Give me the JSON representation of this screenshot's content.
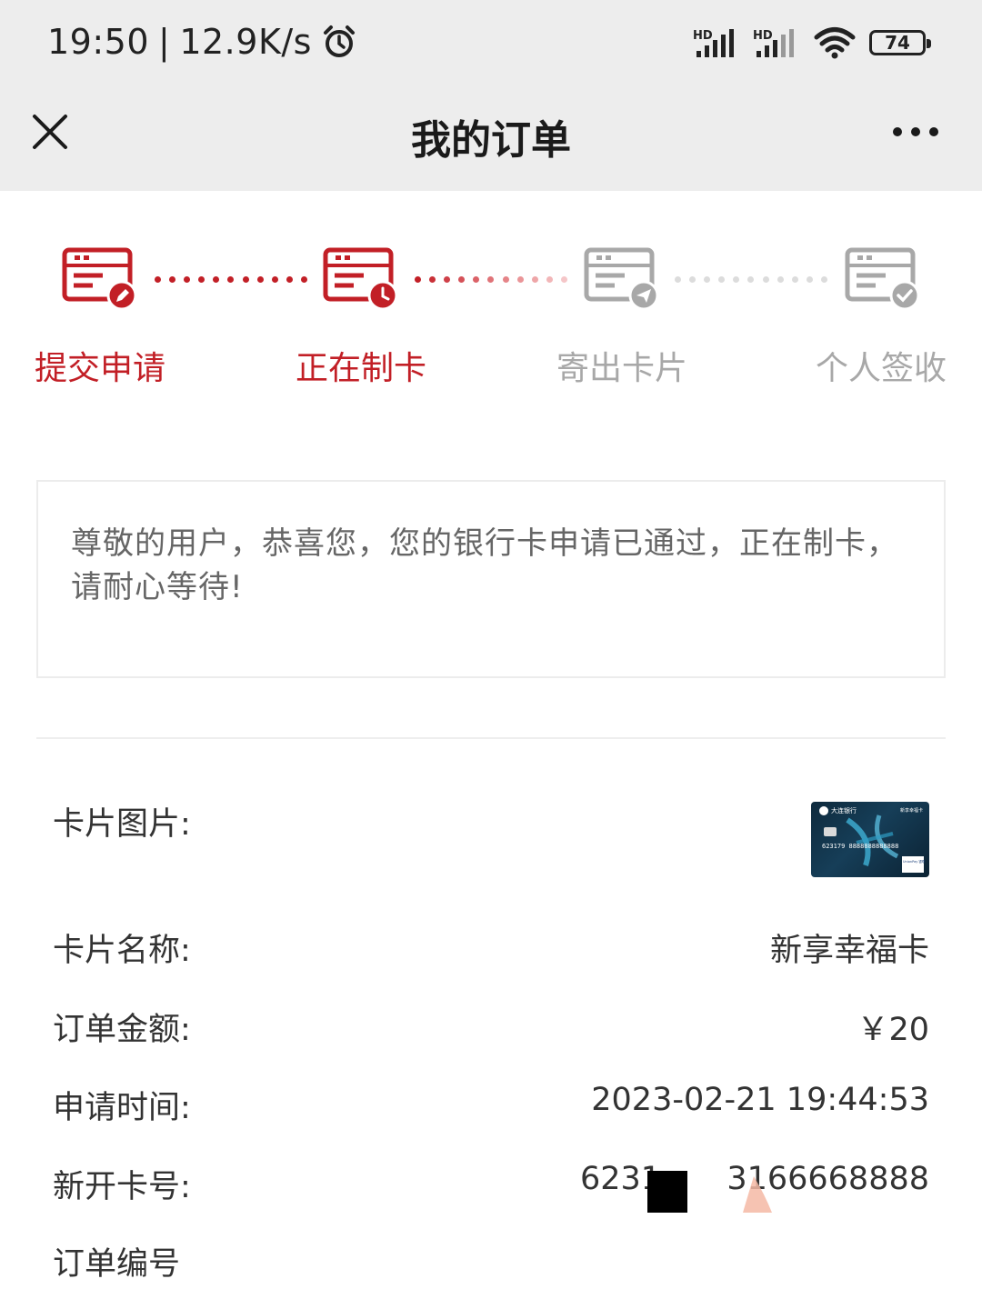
{
  "status_bar": {
    "time": "19:50",
    "separator": "|",
    "speed": "12.9K/s",
    "signal1_label": "HD",
    "signal2_label": "HD",
    "battery": "74"
  },
  "nav": {
    "title": "我的订单"
  },
  "steps": [
    {
      "label": "提交申请",
      "state": "done",
      "icon": "pencil-icon"
    },
    {
      "label": "正在制卡",
      "state": "active",
      "icon": "clock-icon"
    },
    {
      "label": "寄出卡片",
      "state": "pending",
      "icon": "send-icon"
    },
    {
      "label": "个人签收",
      "state": "pending",
      "icon": "check-icon"
    }
  ],
  "colors": {
    "active": "#c21f26",
    "inactive": "#a8a8a8",
    "inactive_dots": "#d9d9d9",
    "bar_bg": "#ededed"
  },
  "message": "尊敬的用户，恭喜您，您的银行卡申请已通过，正在制卡，请耐心等待!",
  "details": {
    "card_image_label": "卡片图片:",
    "card_thumb": {
      "bank_name": "大连银行",
      "product": "新享幸福卡",
      "number": "623179 8888888888888",
      "network": "UnionPay 银联"
    },
    "card_name_label": "卡片名称:",
    "card_name_value": "新享幸福卡",
    "amount_label": "订单金额:",
    "amount_value": "￥20",
    "apply_time_label": "申请时间:",
    "apply_time_value": "2023-02-21 19:44:53",
    "card_no_label": "新开卡号:",
    "card_no_prefix": "6231",
    "card_no_suffix": "3166668888",
    "order_no_label": "订单编号"
  }
}
